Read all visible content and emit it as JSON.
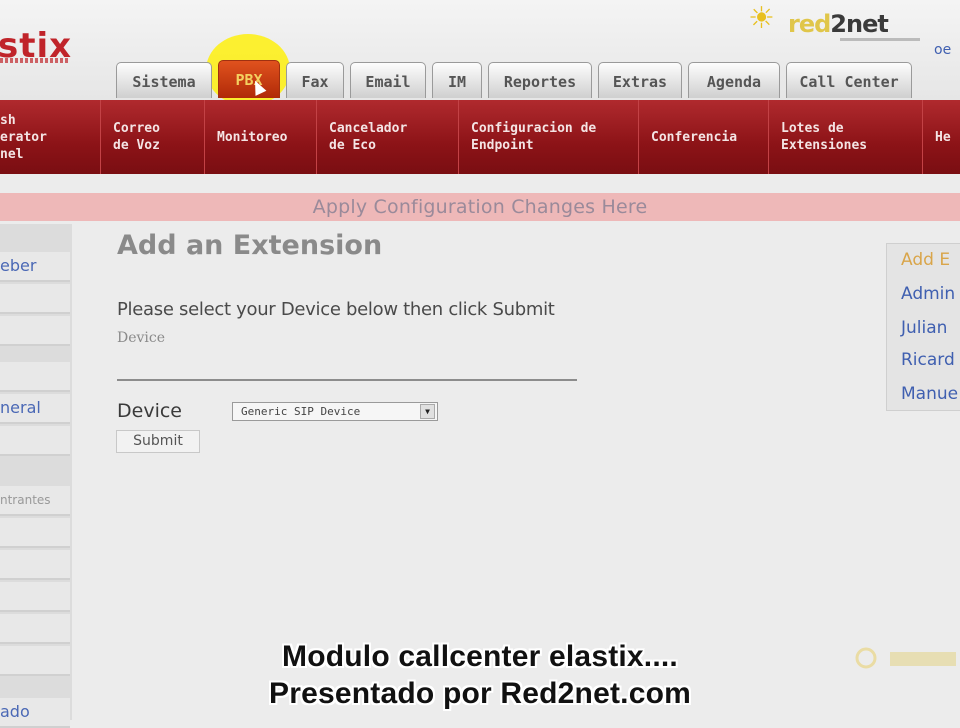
{
  "header": {
    "logo_text": "stix",
    "brand_name_prefix": "red",
    "brand_name_suffix": "2net",
    "corner_link": "oe"
  },
  "tabs": [
    {
      "label": "Sistema",
      "active": false
    },
    {
      "label": "PBX",
      "active": true
    },
    {
      "label": "Fax",
      "active": false
    },
    {
      "label": "Email",
      "active": false
    },
    {
      "label": "IM",
      "active": false
    },
    {
      "label": "Reportes",
      "active": false
    },
    {
      "label": "Extras",
      "active": false
    },
    {
      "label": "Agenda",
      "active": false
    },
    {
      "label": "Call Center",
      "active": false
    }
  ],
  "submenu": [
    {
      "label": "sh\nerator\nnel"
    },
    {
      "label": "Correo\nde Voz"
    },
    {
      "label": "Monitoreo"
    },
    {
      "label": "Cancelador\nde Eco"
    },
    {
      "label": "Configuracion de\nEndpoint"
    },
    {
      "label": "Conferencia"
    },
    {
      "label": "Lotes de\nExtensiones"
    },
    {
      "label": "He"
    }
  ],
  "apply_bar": "Apply Configuration Changes Here",
  "sidebar": [
    {
      "label": "eber"
    },
    {
      "label": ""
    },
    {
      "label": ""
    },
    {
      "label": ""
    },
    {
      "label": "neral"
    },
    {
      "label": ""
    },
    {
      "label": "ntrantes"
    },
    {
      "label": ""
    },
    {
      "label": ""
    },
    {
      "label": ""
    },
    {
      "label": ""
    },
    {
      "label": ""
    },
    {
      "label": "ado"
    }
  ],
  "main": {
    "title": "Add an Extension",
    "instruction": "Please select your Device below then click Submit",
    "section_label": "Device",
    "device_label": "Device",
    "device_value": "Generic SIP Device",
    "submit_label": "Submit"
  },
  "right_panel": [
    {
      "label": "Add E",
      "color": "#d9a54a"
    },
    {
      "label": "Admin",
      "color": "#3f5fb0"
    },
    {
      "label": "Julian",
      "color": "#3f5fb0"
    },
    {
      "label": "Ricard",
      "color": "#3f5fb0"
    },
    {
      "label": "Manue",
      "color": "#3f5fb0"
    }
  ],
  "captions": {
    "line1": "Modulo callcenter elastix....",
    "line2": "Presentado por Red2net.com"
  },
  "colors": {
    "accent_red": "#8c1317",
    "active_tab": "#c4421a",
    "link_blue": "#3f5fb0"
  }
}
